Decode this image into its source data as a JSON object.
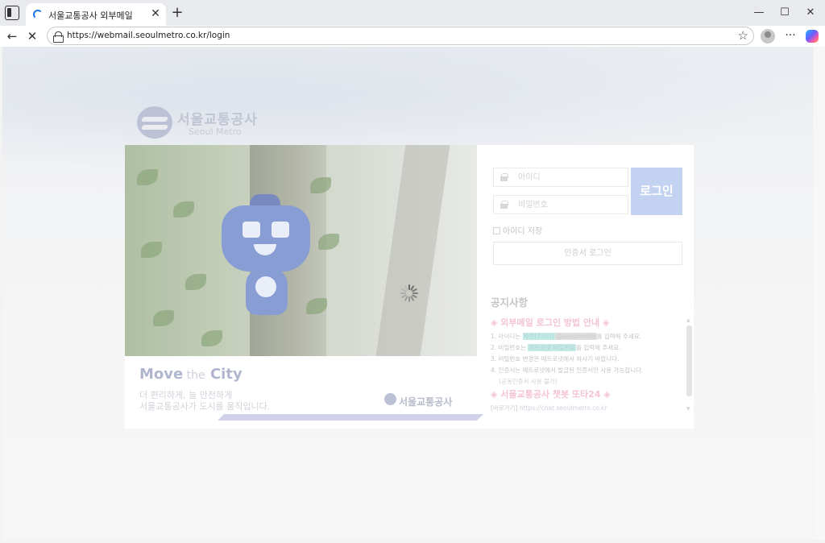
{
  "browser": {
    "tab_title": "서울교통공사 외부메일",
    "tab_close": "✕",
    "new_tab": "+",
    "url": "https://webmail.seoulmetro.co.kr/login",
    "window_minimize": "—",
    "window_maximize": "☐",
    "window_close": "✕",
    "back": "←",
    "stop": "✕",
    "star": "☆",
    "more": "···"
  },
  "brand": {
    "name_ko": "서울교통공사",
    "name_en": "Seoul Metro"
  },
  "hero": {
    "slogan_move": "Move",
    "slogan_the": " the",
    "slogan_city": "City",
    "line1": "더 편리하게, 늘 안전하게",
    "line2": "서울교통공사가 도시를 움직입니다.",
    "footer_logo": "서울교통공사"
  },
  "login": {
    "id_placeholder": "아이디",
    "pw_placeholder": "비밀번호",
    "login_button": "로그인",
    "remember_label": "아이디 저장",
    "cert_login_button": "인증서 로그인"
  },
  "notice": {
    "title": "공지사항",
    "heading1": "◈ 외부메일 로그인 방법 안내 ◈",
    "line1_pre": "1. 아이디는 ",
    "line1_hl1": "사번(7자리)",
    "line1_hl2": "@seoulmetro",
    "line1_post": "를 입력해 주세요.",
    "line2_pre": "2. 비밀번호는 ",
    "line2_hl": "메트로넷 비밀번호",
    "line2_post": "를 입력해 주세요.",
    "line3": "3. 비밀번호 변경은 메트로넷에서 하시기 바랍니다.",
    "line4": "4. 인증서는 메트로넷에서 발급된 인증서만 사용 가능합니다.",
    "line4_sub": "(공동인증서 사용 불가)",
    "heading2": "◈ 서울교통공사 챗봇 또타24 ◈",
    "link_label": "[바로가기] ",
    "link_url": "https://chat.seoulmetro.co.kr"
  },
  "colors": {
    "login_button": "#b7c8ef",
    "notice_heading": "#f2b7c8",
    "brand": "#aeb4cc"
  }
}
